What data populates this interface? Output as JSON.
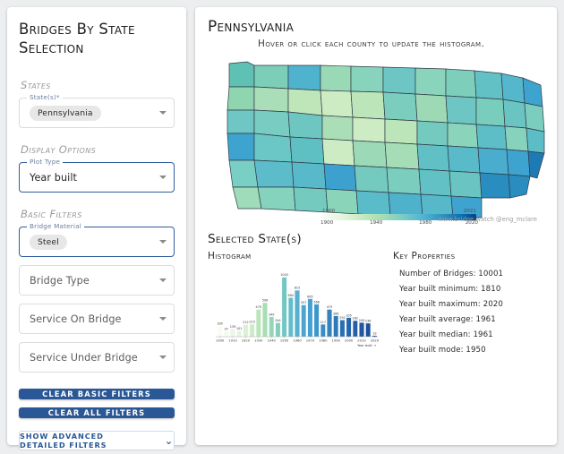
{
  "sidebar": {
    "title": "Bridges By State Selection",
    "sections": {
      "states": "States",
      "display_options": "Display Options",
      "basic_filters": "Basic Filters"
    },
    "fields": [
      {
        "legend": "State(s)*",
        "value": "Pennsylvania",
        "type": "chip",
        "active": false
      },
      {
        "legend": "Plot Type",
        "value": "Year built",
        "type": "text",
        "active": true
      },
      {
        "legend": "Bridge Material",
        "value": "Steel",
        "type": "chip",
        "active": true
      },
      {
        "legend": "",
        "value": "Bridge Type",
        "type": "placeholder",
        "active": false
      },
      {
        "legend": "",
        "value": "Service On Bridge",
        "type": "placeholder",
        "active": false
      },
      {
        "legend": "",
        "value": "Service Under Bridge",
        "type": "placeholder",
        "active": false
      }
    ],
    "buttons": {
      "clear_basic": "Clear Basic Filters",
      "clear_all": "Clear All Filters",
      "advanced": "Show Advanced Detailed Filters",
      "advanced_icon": "chevron-down-icon"
    }
  },
  "main": {
    "title": "Pennsylvania",
    "subtitle": "Hover or click each county to update the histogram.",
    "watermark": "www.bridge.watch @eng_mclare",
    "selected_header": "Selected State(s)",
    "histogram_header": "Histogram",
    "key_properties_header": "Key Properties",
    "colorbar": {
      "min_label": "1900",
      "max_label": "2021",
      "ticks": [
        "1900",
        "1940",
        "1980",
        "2020"
      ]
    },
    "key_properties": [
      "Number of Bridges: 10001",
      "Year built minimum: 1810",
      "Year built maximum: 2020",
      "Year built average: 1961",
      "Year built median: 1961",
      "Year built mode: 1950"
    ]
  },
  "chart_data": {
    "type": "bar",
    "title": "Histogram",
    "xlabel": "Year built →",
    "ylabel": "",
    "xlim": [
      1895,
      2025
    ],
    "ylim": [
      0,
      1100
    ],
    "grid": false,
    "legend": "none",
    "tick_labels": [
      "1900",
      "1910",
      "1920",
      "1930",
      "1940",
      "1950",
      "1960",
      "1970",
      "1980",
      "1990",
      "2000",
      "2010",
      "2020"
    ],
    "categories": [
      "1900",
      "1905",
      "1910",
      "1915",
      "1920",
      "1925",
      "1930",
      "1935",
      "1940",
      "1945",
      "1950",
      "1955",
      "1960",
      "1965",
      "1970",
      "1975",
      "1980",
      "1985",
      "1990",
      "1995",
      "2000",
      "2005",
      "2010",
      "2015",
      "2020"
    ],
    "values": [
      189,
      97,
      139,
      101,
      212,
      219,
      479,
      596,
      349,
      244,
      1043,
      684,
      815,
      557,
      665,
      568,
      217,
      479,
      366,
      292,
      335,
      282,
      249,
      236,
      19
    ],
    "bar_colors": [
      "#f7fcf5",
      "#f2faf0",
      "#eaf7e6",
      "#e2f4dd",
      "#d9f0d3",
      "#cdebc6",
      "#bce4bb",
      "#a9ddb5",
      "#95d6b9",
      "#82cfbe",
      "#71c7c2",
      "#63bcc9",
      "#58b0cf",
      "#4ea3d3",
      "#44a0d0",
      "#3d97cc",
      "#3a8cc4",
      "#3483bd",
      "#2e79b8",
      "#2a6fb2",
      "#2665ab",
      "#2560a6",
      "#2156a0",
      "#1e4f9a",
      "#1b4894"
    ],
    "annotations": "Each bar labeled with its count"
  }
}
